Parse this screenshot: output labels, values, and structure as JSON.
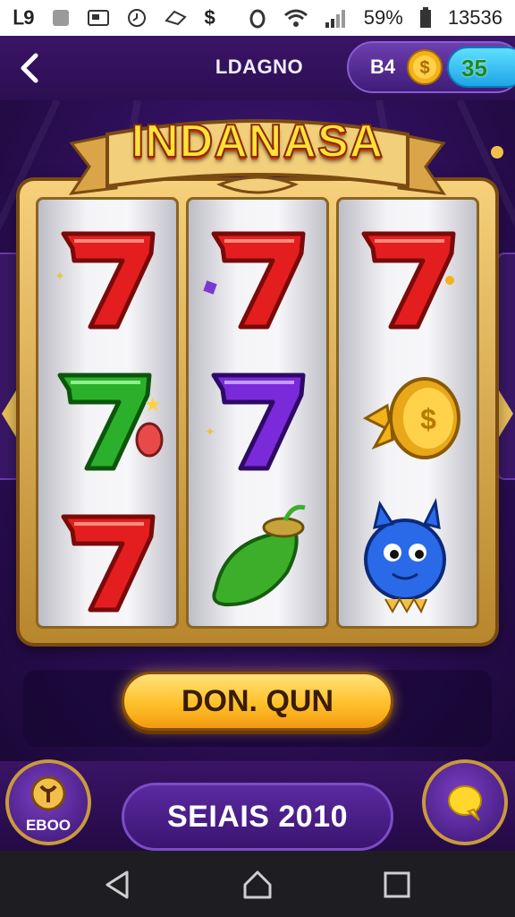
{
  "status_bar": {
    "left_text": "ᒪ9",
    "battery_percent": "59%",
    "time": "13536"
  },
  "header": {
    "title": "LDAGNO",
    "currency_label": "B4",
    "gem_value": "35"
  },
  "game": {
    "banner_title": "INDANASA",
    "reels": [
      [
        "red-seven",
        "green-seven",
        "red-seven"
      ],
      [
        "red-seven",
        "purple-seven",
        "green-pepper"
      ],
      [
        "red-seven",
        "gold-coin-bow",
        "blue-monster"
      ]
    ],
    "spin_label": "DON. QUN"
  },
  "bottom": {
    "left_button_label": "EBOO",
    "bet_label": "SEIAIS 2010"
  },
  "colors": {
    "header_bg": "#3a1466",
    "gold": "#ffc12a",
    "gem_blue": "#1ea4e6"
  }
}
